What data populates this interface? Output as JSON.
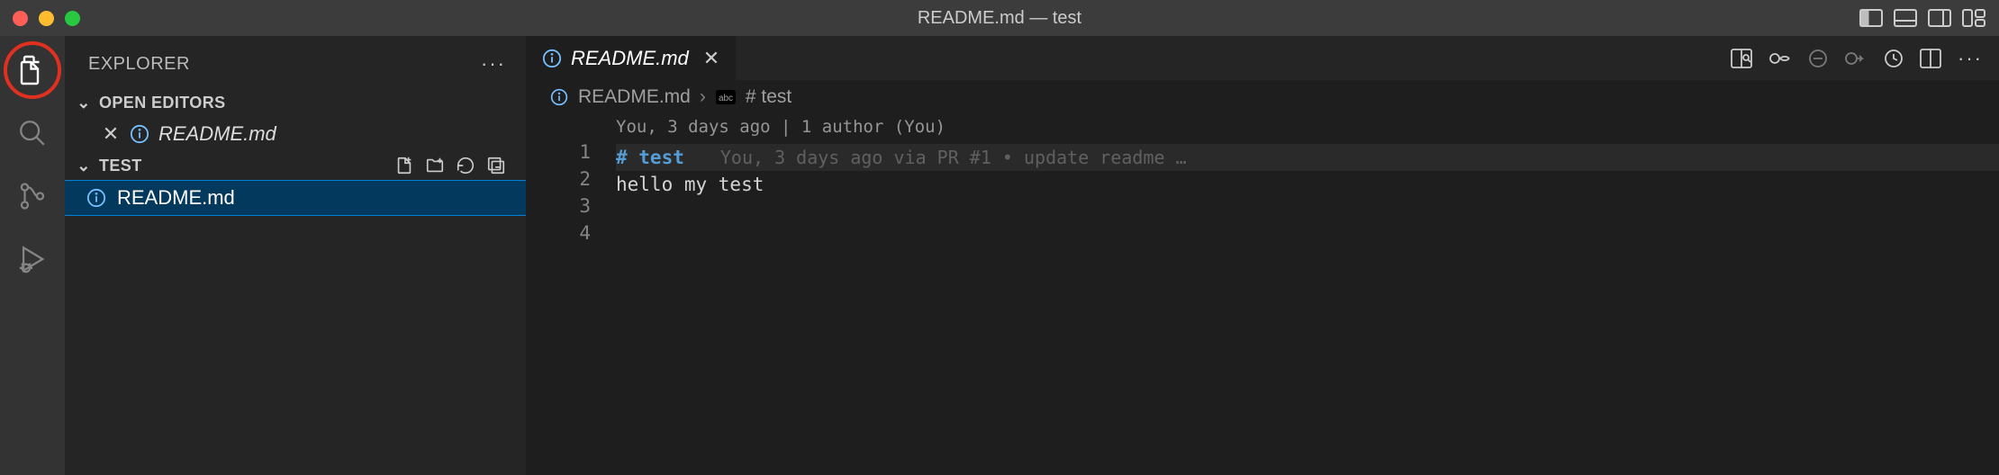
{
  "titlebar": {
    "title": "README.md — test"
  },
  "sidebar": {
    "title": "EXPLORER",
    "openEditors": {
      "header": "OPEN EDITORS",
      "items": [
        {
          "name": "README.md"
        }
      ]
    },
    "folder": {
      "name": "TEST",
      "files": [
        {
          "name": "README.md"
        }
      ]
    }
  },
  "editor": {
    "tab": {
      "name": "README.md"
    },
    "breadcrumb": {
      "file": "README.md",
      "symbol": "# test"
    },
    "codelens": "You, 3 days ago | 1 author (You)",
    "lineNumbers": [
      "1",
      "2",
      "3",
      "4"
    ],
    "line1": "# test",
    "blame1": "You, 3 days ago via PR #1 • update readme …",
    "line2": "",
    "line3": "hello my test",
    "line4": ""
  }
}
